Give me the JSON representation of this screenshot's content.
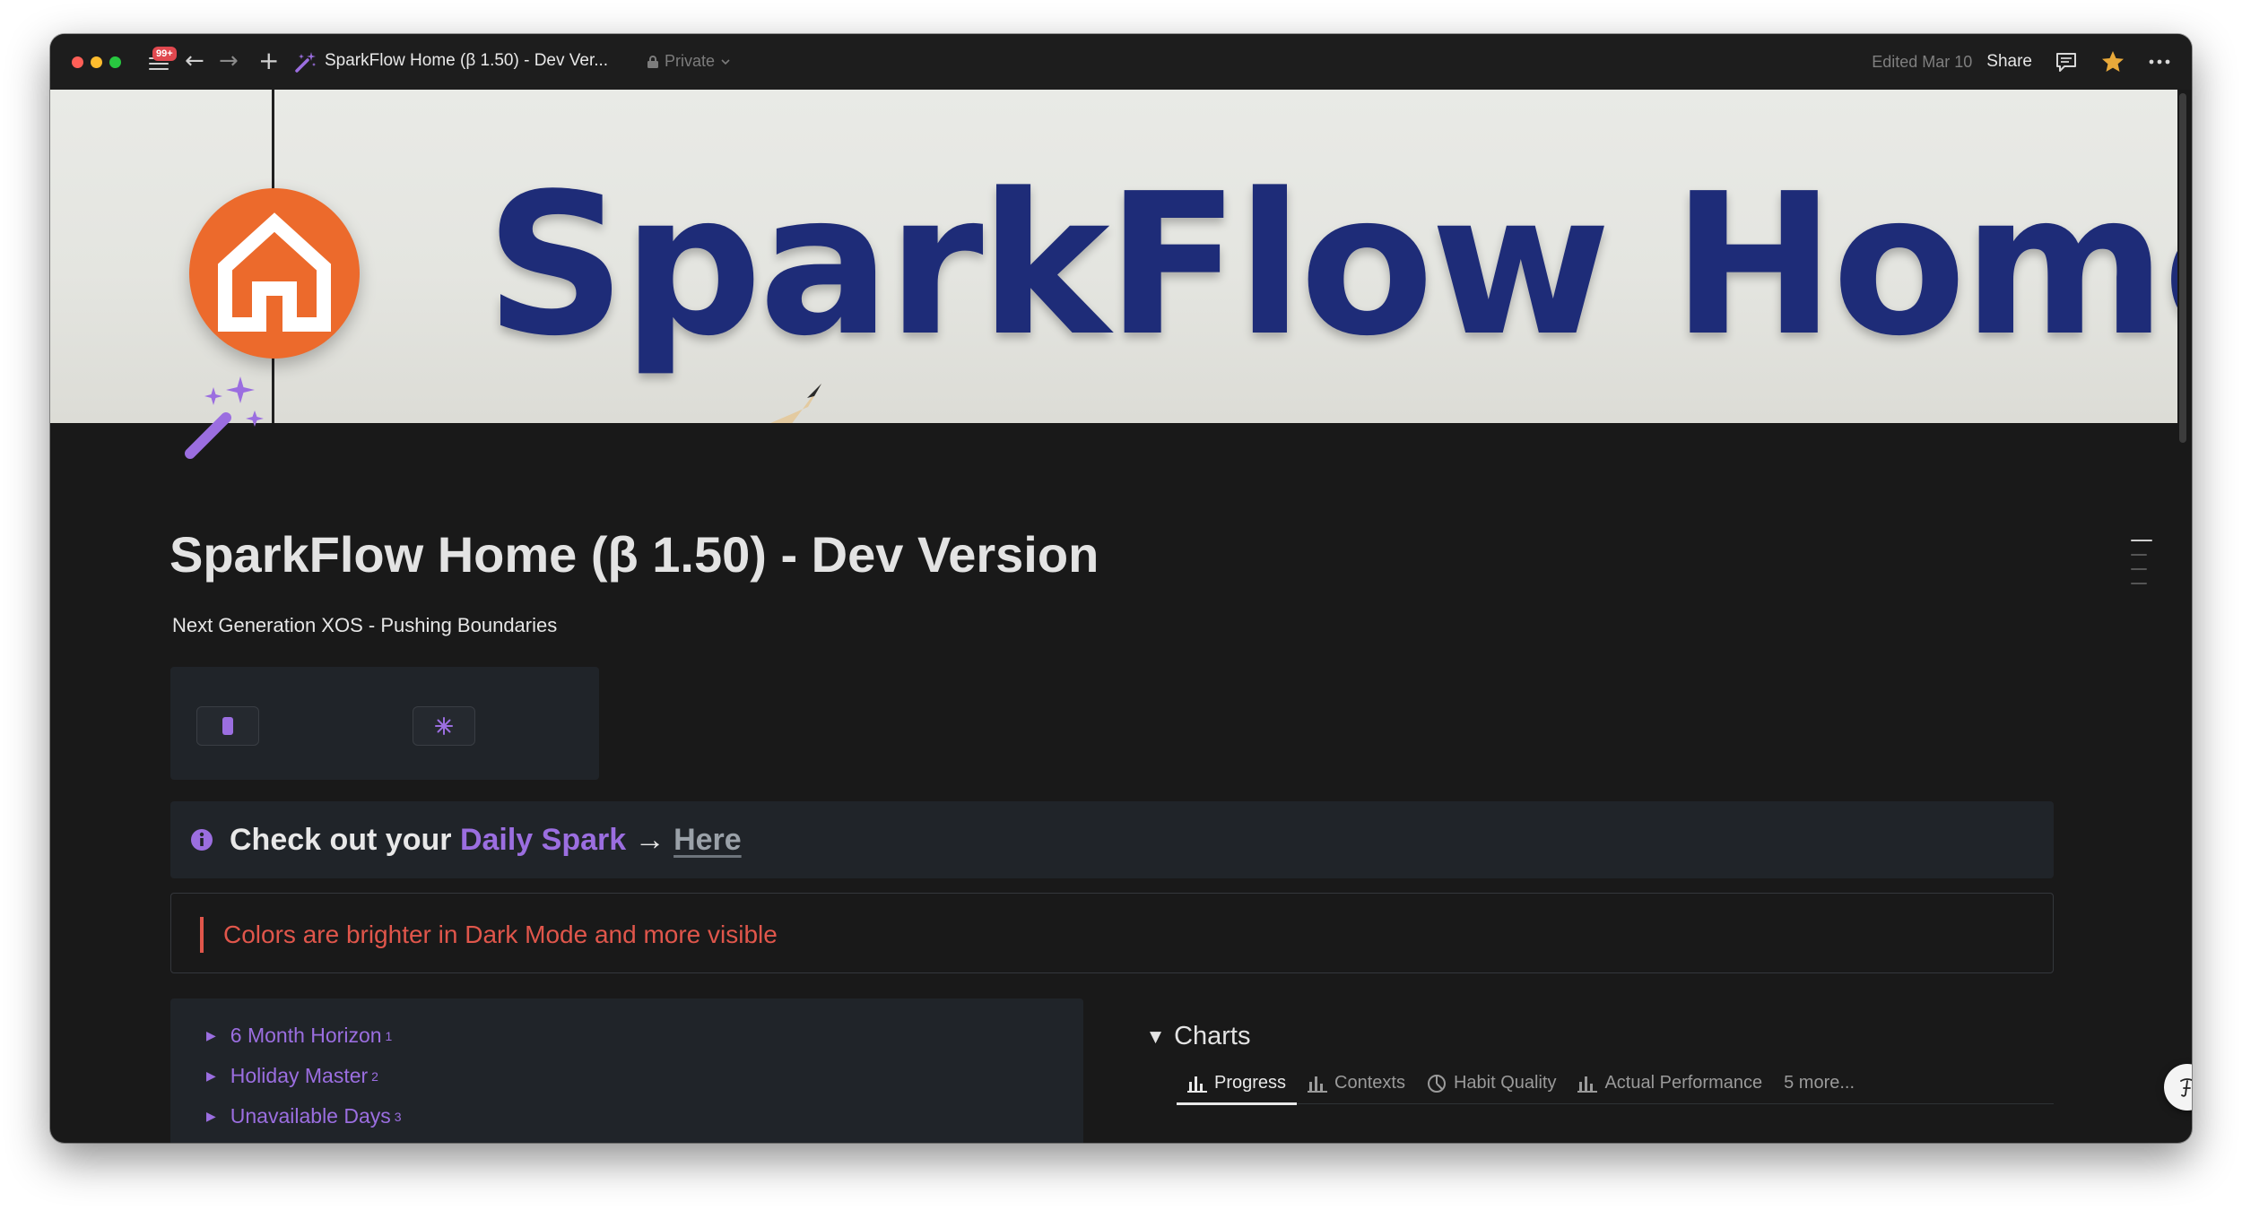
{
  "titlebar": {
    "notification_badge": "99+",
    "tab_title": "SparkFlow Home (β 1.50) - Dev Ver...",
    "privacy": "Private",
    "edited": "Edited Mar 10",
    "share_label": "Share"
  },
  "cover": {
    "banner_title": "SparkFlow Home"
  },
  "page": {
    "title": "SparkFlow Home (β 1.50)  - Dev Version",
    "subtitle": "Next Generation XOS - Pushing Boundaries"
  },
  "callout": {
    "prefix": "Check out your ",
    "highlight": "Daily Spark",
    "arrow": " → ",
    "link": "Here"
  },
  "quote": {
    "text": "Colors are brighter in Dark Mode and more visible"
  },
  "toggles": [
    {
      "label": "6 Month Horizon",
      "note": "1"
    },
    {
      "label": "Holiday Master",
      "note": "2"
    },
    {
      "label": "Unavailable Days",
      "note": "3"
    }
  ],
  "charts": {
    "heading": "Charts",
    "tabs": [
      {
        "label": "Progress",
        "icon": "bar-chart-icon"
      },
      {
        "label": "Contexts",
        "icon": "bar-chart-icon"
      },
      {
        "label": "Habit Quality",
        "icon": "pie-chart-icon"
      },
      {
        "label": "Actual Performance",
        "icon": "bar-chart-icon"
      },
      {
        "label": "5 more..."
      }
    ]
  },
  "colors": {
    "accent_purple": "#9b6ee0",
    "quote_red": "#e0564b",
    "banner_navy": "#1e2c78",
    "logo_orange": "#ec6a2c",
    "background": "#191919"
  }
}
